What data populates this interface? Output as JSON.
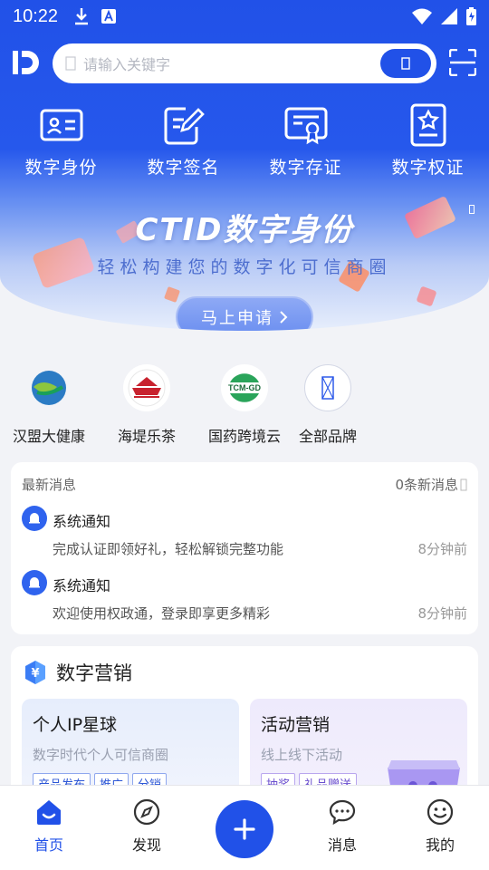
{
  "status_bar": {
    "time": "10:22"
  },
  "search": {
    "placeholder": "请输入关键字"
  },
  "quick_actions": [
    {
      "label": "数字身份",
      "icon": "id-card-icon"
    },
    {
      "label": "数字签名",
      "icon": "signature-icon"
    },
    {
      "label": "数字存证",
      "icon": "certificate-icon"
    },
    {
      "label": "数字权证",
      "icon": "rights-badge-icon"
    }
  ],
  "banner": {
    "title": "CTID数字身份",
    "subtitle": "轻松构建您的数字化可信商圈",
    "button": "马上申请"
  },
  "brands": [
    {
      "label": "汉盟大健康"
    },
    {
      "label": "海堤乐茶"
    },
    {
      "label": "国药跨境云",
      "logo_text": "TCM-GD"
    },
    {
      "label": "全部品牌"
    }
  ],
  "news": {
    "title": "最新消息",
    "count": "0条新消息",
    "items": [
      {
        "title": "系统通知",
        "text": "完成认证即领好礼，轻松解锁完整功能",
        "time": "8分钟前"
      },
      {
        "title": "系统通知",
        "text": "欢迎使用权政通，登录即享更多精彩",
        "time": "8分钟前"
      }
    ]
  },
  "marketing": {
    "title": "数字营销",
    "boxes": [
      {
        "title": "个人IP星球",
        "subtitle": "数字时代个人可信商圈",
        "tags": [
          "产品发布",
          "推广",
          "分销"
        ]
      },
      {
        "title": "活动营销",
        "subtitle": "线上线下活动",
        "tags": [
          "抽奖",
          "礼品赠送"
        ]
      }
    ]
  },
  "tabs": [
    {
      "label": "首页",
      "icon": "home-icon",
      "active": true
    },
    {
      "label": "发现",
      "icon": "compass-icon"
    },
    {
      "label": "消息",
      "icon": "chat-icon"
    },
    {
      "label": "我的",
      "icon": "smile-icon"
    }
  ],
  "colors": {
    "primary": "#2151e8",
    "background": "#f2f3f7"
  }
}
